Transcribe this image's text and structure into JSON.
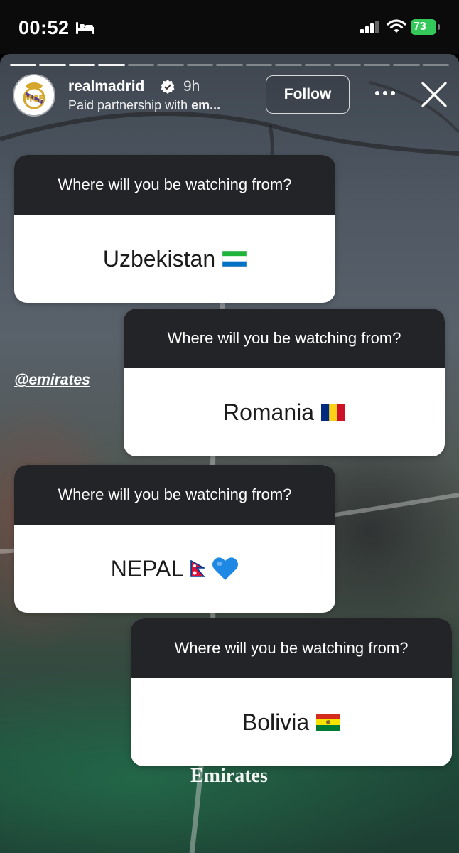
{
  "status_bar": {
    "time": "00:52",
    "battery": "73"
  },
  "story": {
    "progress_total": 15,
    "progress_done": 4,
    "username": "realmadrid",
    "time_ago": "9h",
    "partnership_prefix": "Paid partnership with ",
    "partnership_name": "em...",
    "follow_label": "Follow",
    "mention": "@emirates",
    "brand": "Emirates"
  },
  "cards": [
    {
      "question": "Where will you be watching from?",
      "answer": "Uzbekistan",
      "flag": "sierra-leone-flag"
    },
    {
      "question": "Where will you be watching from?",
      "answer": "Romania",
      "flag": "romania-flag"
    },
    {
      "question": "Where will you be watching from?",
      "answer": "NEPAL",
      "flag": "nepal-flag",
      "extra": "blue-heart"
    },
    {
      "question": "Where will you be watching from?",
      "answer": "Bolivia",
      "flag": "bolivia-flag"
    }
  ],
  "colors": {
    "battery": "#34c759",
    "card_header": "#232427",
    "heart": "#1e88e5"
  }
}
